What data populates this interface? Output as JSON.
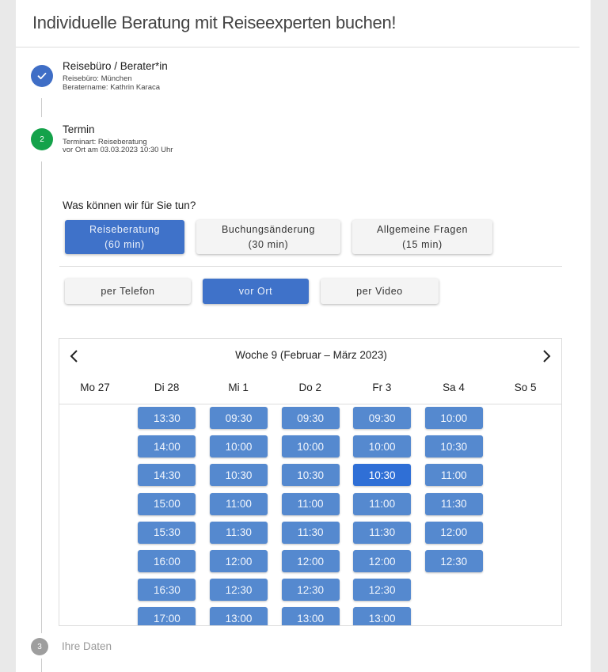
{
  "page_title": "Individuelle Beratung mit Reiseexperten buchen!",
  "steps": [
    {
      "number": "1",
      "title": "Reisebüro / Berater*in",
      "lines": [
        "Reisebüro: München",
        "Beratername: Kathrin Karaca"
      ],
      "status": "done"
    },
    {
      "number": "2",
      "title": "Termin",
      "lines": [
        "Terminart: Reiseberatung",
        "vor Ort am 03.03.2023 10:30 Uhr"
      ],
      "status": "active"
    },
    {
      "number": "3",
      "title": "Ihre Daten",
      "status": "pending"
    }
  ],
  "question": "Was können wir für Sie tun?",
  "services": [
    {
      "name": "Reiseberatung",
      "duration": "(60 min)",
      "selected": true
    },
    {
      "name": "Buchungsänderung",
      "duration": "(30 min)",
      "selected": false
    },
    {
      "name": "Allgemeine Fragen",
      "duration": "(15 min)",
      "selected": false
    }
  ],
  "modes": [
    {
      "label": "per Telefon",
      "selected": false
    },
    {
      "label": "vor Ort",
      "selected": true
    },
    {
      "label": "per Video",
      "selected": false
    }
  ],
  "calendar": {
    "week_label": "Woche 9 (Februar – März 2023)",
    "prev_icon": "chevron-left-icon",
    "next_icon": "chevron-right-icon",
    "days": [
      {
        "label": "Mo 27",
        "slots": []
      },
      {
        "label": "Di 28",
        "slots": [
          "13:30",
          "14:00",
          "14:30",
          "15:00",
          "15:30",
          "16:00",
          "16:30",
          "17:00"
        ]
      },
      {
        "label": "Mi 1",
        "slots": [
          "09:30",
          "10:00",
          "10:30",
          "11:00",
          "11:30",
          "12:00",
          "12:30",
          "13:00"
        ]
      },
      {
        "label": "Do 2",
        "slots": [
          "09:30",
          "10:00",
          "10:30",
          "11:00",
          "11:30",
          "12:00",
          "12:30",
          "13:00"
        ]
      },
      {
        "label": "Fr 3",
        "slots": [
          "09:30",
          "10:00",
          "10:30",
          "11:00",
          "11:30",
          "12:00",
          "12:30",
          "13:00"
        ]
      },
      {
        "label": "Sa 4",
        "slots": [
          "10:00",
          "10:30",
          "11:00",
          "11:30",
          "12:00",
          "12:30"
        ]
      },
      {
        "label": "So 5",
        "slots": []
      }
    ],
    "selected": {
      "day": "Fr 3",
      "time": "10:30"
    }
  },
  "colors": {
    "primary": "#3f72c9",
    "slot": "#5589cf",
    "slot_active": "#2f6fd6",
    "step_done": "#3f6ec6",
    "step_active": "#14a24a",
    "step_pending": "#9e9e9e"
  }
}
